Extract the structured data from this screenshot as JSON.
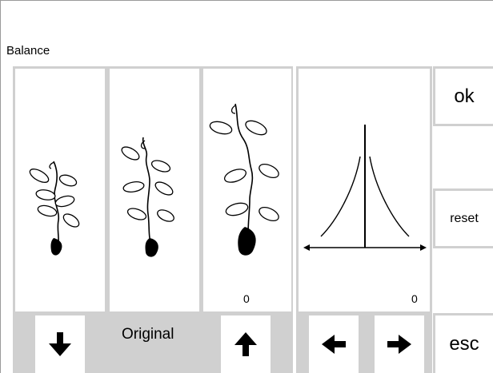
{
  "title": "Balance",
  "stitches": {
    "value_right": "0"
  },
  "graph": {
    "value": "0"
  },
  "buttons": {
    "ok": "ok",
    "reset": "reset",
    "esc": "esc",
    "original": "Original"
  },
  "icons": {
    "down": "arrow-down-icon",
    "up": "arrow-up-icon",
    "left": "arrow-left-icon",
    "right": "arrow-right-icon"
  },
  "colors": {
    "panel": "#d0d0d0",
    "frame": "#9a9a9a",
    "white": "#ffffff",
    "ink": "#000000"
  }
}
